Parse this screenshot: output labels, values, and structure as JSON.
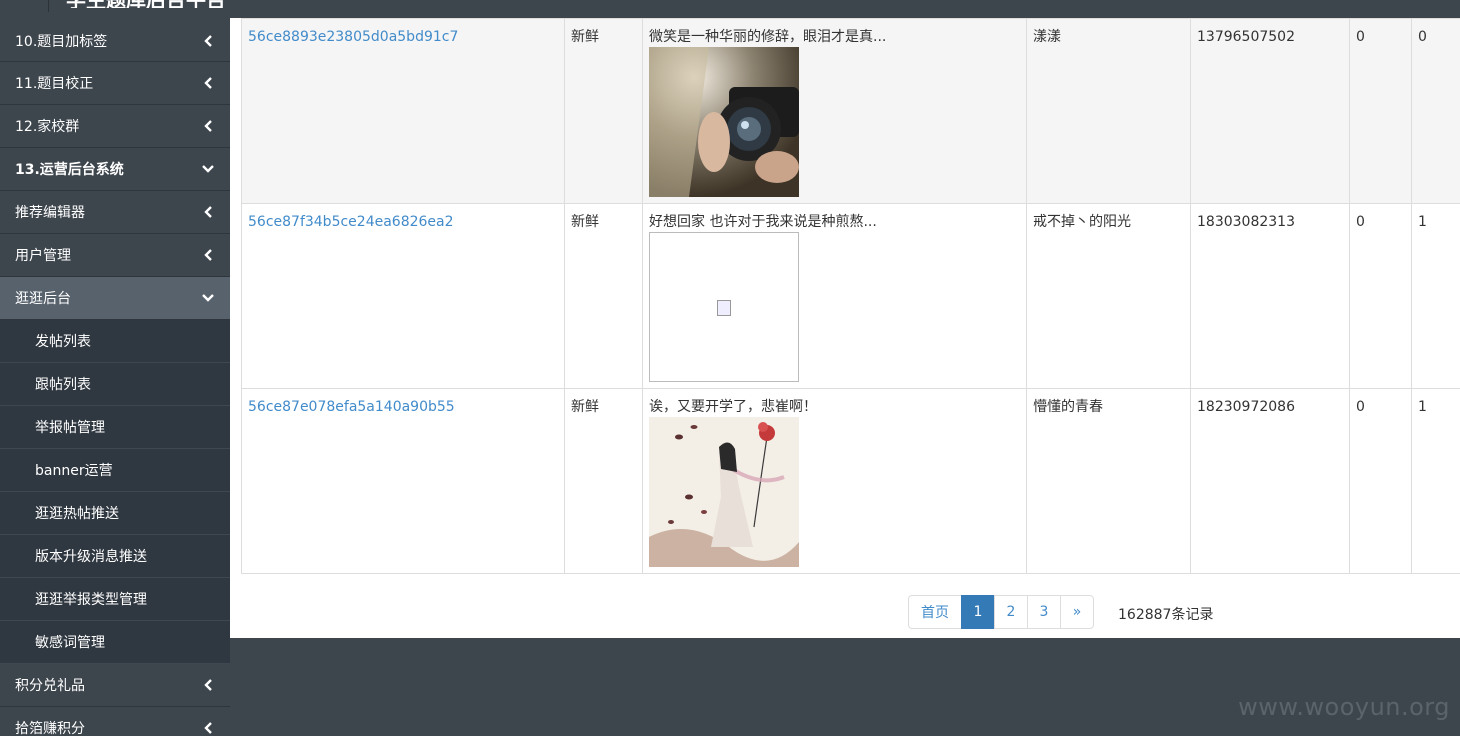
{
  "header": {
    "title": "学生题库后台平台"
  },
  "sidebar": {
    "items": [
      {
        "label": "10.题目加标签",
        "state": "collapsed"
      },
      {
        "label": "11.题目校正",
        "state": "collapsed"
      },
      {
        "label": "12.家校群",
        "state": "collapsed"
      },
      {
        "label": "13.运营后台系统",
        "state": "expanded"
      },
      {
        "label": "推荐编辑器",
        "state": "collapsed"
      },
      {
        "label": "用户管理",
        "state": "collapsed"
      },
      {
        "label": "逛逛后台",
        "state": "expanded"
      },
      {
        "label": "发帖列表"
      },
      {
        "label": "跟帖列表"
      },
      {
        "label": "举报帖管理"
      },
      {
        "label": "banner运营"
      },
      {
        "label": "逛逛热帖推送"
      },
      {
        "label": "版本升级消息推送"
      },
      {
        "label": "逛逛举报类型管理"
      },
      {
        "label": "敏感词管理"
      },
      {
        "label": "积分兑礼品",
        "state": "collapsed"
      },
      {
        "label": "拾箔赚积分",
        "state": "collapsed"
      }
    ]
  },
  "table": {
    "rows": [
      {
        "id": "56ce8893e23805d0a5bd91c7",
        "tag": "新鲜",
        "content": "微笑是一种华丽的修辞，眼泪才是真...",
        "image": "camera-girl-photo",
        "nickname": "漾漾",
        "phone": "13796507502",
        "col6": "0",
        "col7": "0"
      },
      {
        "id": "56ce87f34b5ce24ea6826ea2",
        "tag": "新鲜",
        "content": "好想回家 也许对于我来说是种煎熬...",
        "image": "broken-image",
        "nickname": "戒不掉丶的阳光",
        "phone": "18303082313",
        "col6": "0",
        "col7": "1"
      },
      {
        "id": "56ce87e078efa5a140a90b55",
        "tag": "新鲜",
        "content": "诶，又要开学了，悲崔啊！",
        "image": "ink-painting-girl",
        "nickname": "懵懂的青春",
        "phone": "18230972086",
        "col6": "0",
        "col7": "1"
      }
    ]
  },
  "pagination": {
    "first_label": "首页",
    "pages": [
      "1",
      "2",
      "3"
    ],
    "active_page": "1",
    "next_label": "»",
    "records": "162887条记录"
  },
  "watermark": "www.wooyun.org",
  "colors": {
    "sidebar_bg": "#3d454d",
    "active_bg": "#57626d",
    "sub_bg": "#2f3740",
    "link": "#428bca",
    "page_active": "#337ab7"
  }
}
